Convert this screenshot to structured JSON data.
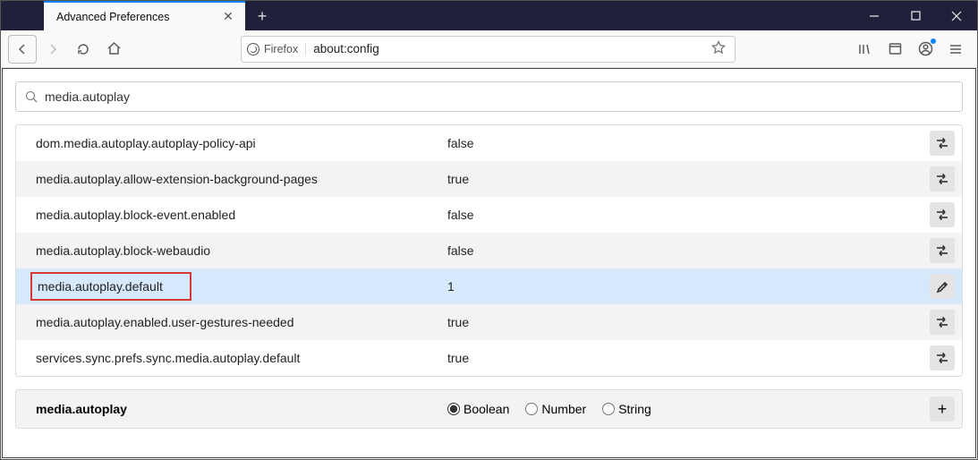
{
  "window": {
    "tab_title": "Advanced Preferences"
  },
  "urlbar": {
    "identity": "Firefox",
    "url": "about:config"
  },
  "search": {
    "value": "media.autoplay"
  },
  "prefs": [
    {
      "name": "dom.media.autoplay.autoplay-policy-api",
      "value": "false",
      "action": "toggle",
      "selected": false
    },
    {
      "name": "media.autoplay.allow-extension-background-pages",
      "value": "true",
      "action": "toggle",
      "selected": false
    },
    {
      "name": "media.autoplay.block-event.enabled",
      "value": "false",
      "action": "toggle",
      "selected": false
    },
    {
      "name": "media.autoplay.block-webaudio",
      "value": "false",
      "action": "toggle",
      "selected": false
    },
    {
      "name": "media.autoplay.default",
      "value": "1",
      "action": "edit",
      "selected": true,
      "highlighted": true
    },
    {
      "name": "media.autoplay.enabled.user-gestures-needed",
      "value": "true",
      "action": "toggle",
      "selected": false
    },
    {
      "name": "services.sync.prefs.sync.media.autoplay.default",
      "value": "true",
      "action": "toggle",
      "selected": false
    }
  ],
  "add": {
    "name": "media.autoplay",
    "types": [
      "Boolean",
      "Number",
      "String"
    ],
    "selected_type": "Boolean"
  }
}
